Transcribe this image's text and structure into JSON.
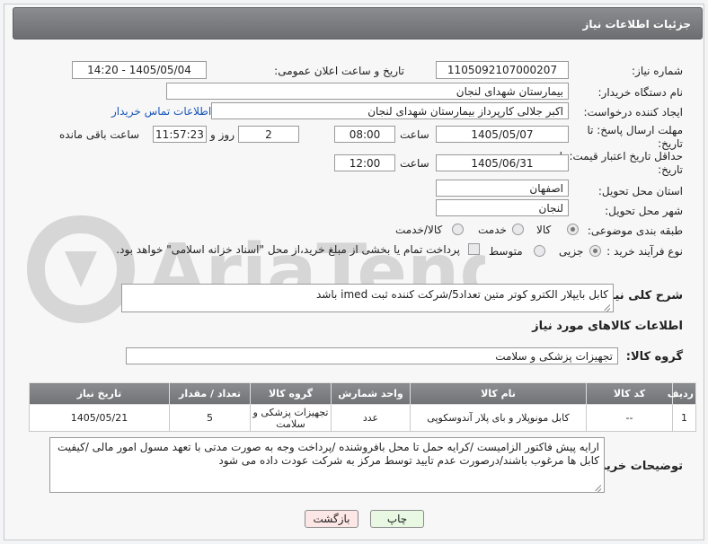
{
  "header": {
    "title": "جزئیات اطلاعات نیاز"
  },
  "fields": {
    "need_number": {
      "label": "شماره نیاز:",
      "value": "1105092107000207"
    },
    "announce_datetime": {
      "label": "تاریخ و ساعت اعلان عمومی:",
      "value": "1405/05/04 - 14:20"
    },
    "buyer_org": {
      "label": "نام دستگاه خریدار:",
      "value": "بیمارستان شهدای لنجان"
    },
    "creator": {
      "label": "ایجاد کننده درخواست:",
      "value": "اکبر جلالی کارپرداز بیمارستان شهدای لنجان",
      "contact_link": "اطلاعات تماس خریدار"
    },
    "reply_deadline": {
      "label": "مهلت ارسال پاسخ: تا تاریخ:",
      "date": "1405/05/07",
      "time_label": "ساعت",
      "time": "08:00",
      "days": "2",
      "days_label": "روز و",
      "remaining": "11:57:23",
      "remaining_label": "ساعت باقی مانده"
    },
    "price_validity": {
      "label": "حداقل تاریخ اعتبار قیمت: تا تاریخ:",
      "date": "1405/06/31",
      "time_label": "ساعت",
      "time": "12:00"
    },
    "province": {
      "label": "استان محل تحویل:",
      "value": "اصفهان"
    },
    "city": {
      "label": "شهر محل تحویل:",
      "value": "لنجان"
    },
    "category": {
      "label": "طبقه بندی موضوعی:",
      "options": [
        "کالا",
        "خدمت",
        "کالا/خدمت"
      ],
      "selected": "کالا"
    },
    "process": {
      "label": "نوع فرآیند خرید :",
      "options": [
        "جزیی",
        "متوسط"
      ],
      "selected": "جزیی",
      "note": "پرداخت تمام یا بخشی از مبلغ خرید،از محل \"اسناد خزانه اسلامی\" خواهد بود."
    }
  },
  "description": {
    "label": "شرح کلی نیاز:",
    "value": "کابل بایپلار الکترو کوتر متین تعداد5/شرکت کننده ثبت imed باشد"
  },
  "goods_info": {
    "title": "اطلاعات کالاهای مورد نیاز"
  },
  "goods_group": {
    "label": "گروه کالا:",
    "value": "تجهیزات پزشکی و سلامت"
  },
  "table": {
    "headers": [
      "ردیف",
      "کد کالا",
      "نام کالا",
      "واحد شمارش",
      "گروه کالا",
      "تعداد / مقدار",
      "تاریخ نیاز"
    ],
    "rows": [
      [
        "1",
        "--",
        "کابل مونوپلار و بای پلار آندوسکوپی",
        "عدد",
        "تجهیزات پزشکی و سلامت",
        "5",
        "1405/05/21"
      ]
    ]
  },
  "buyer_notes": {
    "label": "توضیحات خریدار:",
    "value": "ارایه پیش فاکتور الزامیست /کرایه حمل تا محل بافروشنده /پرداخت وجه به صورت مدتی با تعهد مسول امور مالی /کیفیت کابل ها مرغوب باشند/درصورت عدم تایید توسط مرکز به شرکت عودت داده می شود"
  },
  "buttons": {
    "print": "چاپ",
    "back": "بازگشت"
  },
  "watermark": {
    "text": "AriaTender.neT"
  },
  "colors": {
    "header_bg": "#7a7c80",
    "link": "#1a56b8",
    "print_btn": "#e8f8e2",
    "back_btn": "#fde6e6"
  }
}
